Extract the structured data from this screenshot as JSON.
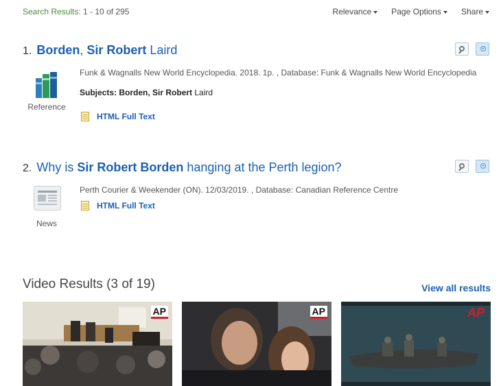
{
  "header": {
    "count_label": "Search Results:",
    "count_value": "1 - 10 of 295",
    "sort_label": "Relevance",
    "page_options_label": "Page Options",
    "share_label": "Share"
  },
  "results": [
    {
      "number": "1.",
      "title_bold_1": "Borden",
      "title_sep": ", ",
      "title_bold_2": "Sir Robert",
      "title_rest": " Laird",
      "type_label": "Reference",
      "meta": "Funk & Wagnalls New World Encyclopedia. 2018. 1p. , Database: Funk & Wagnalls New World Encyclopedia",
      "subjects_label": "Subjects:",
      "subjects_bold": "Borden, Sir Robert",
      "subjects_rest": " Laird",
      "fulltext_label": "HTML Full Text"
    },
    {
      "number": "2.",
      "title_pre": "Why is ",
      "title_bold": "Sir Robert Borden",
      "title_rest": " hanging at the Perth legion?",
      "type_label": "News",
      "meta": "Perth Courier & Weekender (ON). 12/03/2019. , Database: Canadian Reference Centre",
      "fulltext_label": "HTML Full Text"
    }
  ],
  "videos": {
    "heading": "Video Results (3 of 19)",
    "view_all": "View all results",
    "thumbs": [
      {
        "badge": "AP",
        "scene": "courtroom"
      },
      {
        "badge": "AP",
        "scene": "crowd"
      },
      {
        "badge": "AP",
        "scene": "boat"
      }
    ]
  },
  "colors": {
    "link": "#1a5fb4",
    "count_label": "#4a8a3a",
    "ap_red": "#d11f2a"
  }
}
